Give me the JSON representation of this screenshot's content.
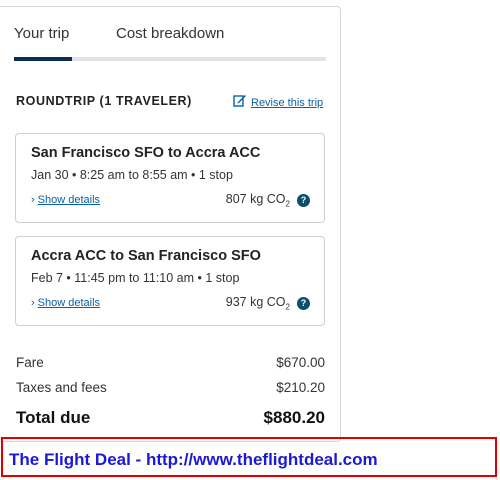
{
  "tabs": [
    {
      "label": "Your trip",
      "active": true
    },
    {
      "label": "Cost breakdown",
      "active": false
    }
  ],
  "trip": {
    "heading": "ROUNDTRIP (1 TRAVELER)",
    "revise_label": "Revise this trip"
  },
  "flights": [
    {
      "route": "San Francisco SFO to Accra ACC",
      "times": "Jan 30 • 8:25 am to 8:55 am • 1 stop",
      "details_label": "Show details",
      "co2_value": "807 kg CO",
      "co2_sub": "2"
    },
    {
      "route": "Accra ACC to San Francisco SFO",
      "times": "Feb 7 • 11:45 pm to 11:10 am • 1 stop",
      "details_label": "Show details",
      "co2_value": "937 kg CO",
      "co2_sub": "2"
    }
  ],
  "costs": {
    "fare_label": "Fare",
    "fare_value": "$670.00",
    "taxes_label": "Taxes and fees",
    "taxes_value": "$210.20",
    "total_label": "Total due",
    "total_value": "$880.20"
  },
  "banner": {
    "text": "The Flight Deal - http://www.theflightdeal.com"
  },
  "colors": {
    "accent": "#0b2d4f",
    "link": "#0b5fa5",
    "banner_border": "#e00000",
    "banner_text": "#1a1ad6"
  }
}
